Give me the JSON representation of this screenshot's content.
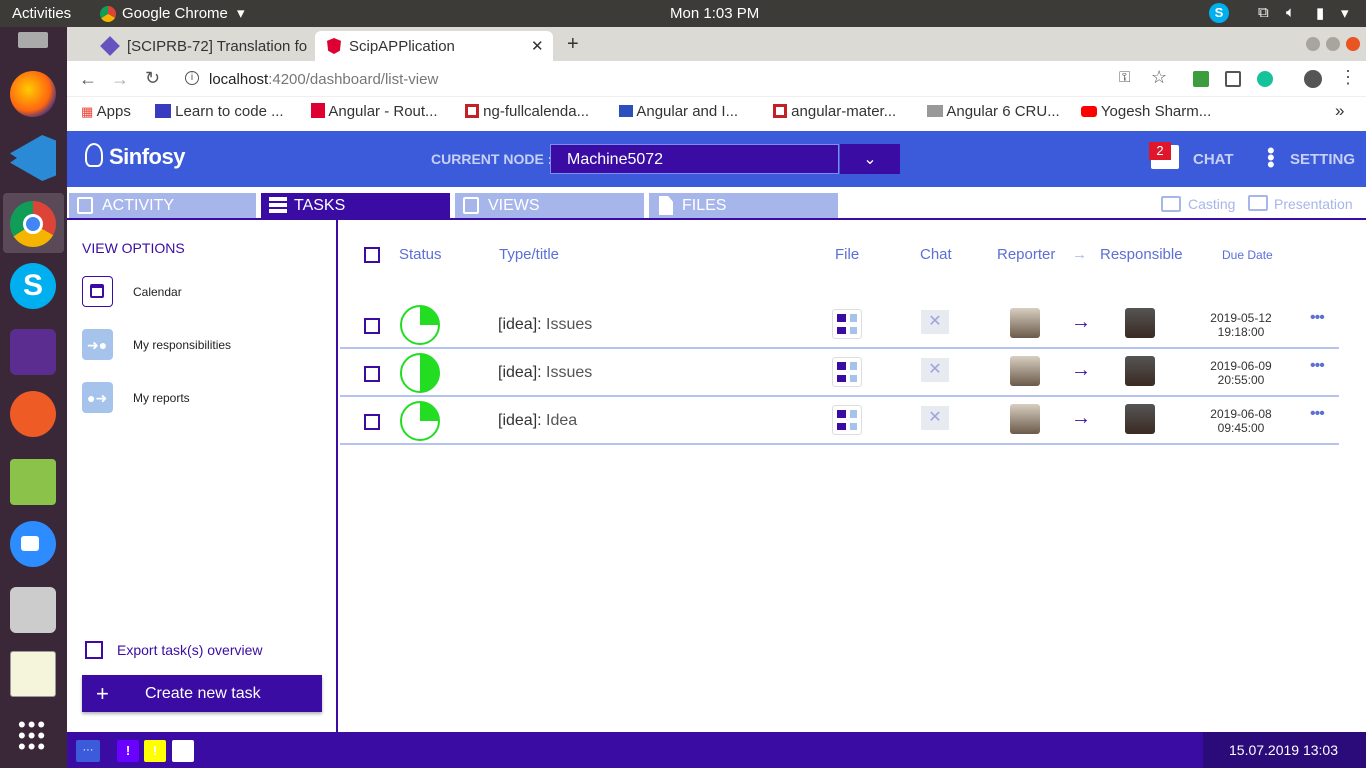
{
  "os": {
    "activities": "Activities",
    "app_menu": "Google Chrome",
    "clock": "Mon  1:03 PM"
  },
  "browser": {
    "tabs": [
      {
        "label": "[SCIPRB-72] Translation fo"
      },
      {
        "label": "ScipAPPlication"
      }
    ],
    "url_host": "localhost",
    "url_path": ":4200/dashboard/list-view",
    "bookmarks": [
      {
        "label": "Apps"
      },
      {
        "label": "Learn to code ..."
      },
      {
        "label": "Angular - Rout..."
      },
      {
        "label": "ng-fullcalenda..."
      },
      {
        "label": "Angular and I..."
      },
      {
        "label": "angular-mater..."
      },
      {
        "label": "Angular 6 CRU..."
      },
      {
        "label": "Yogesh Sharm..."
      }
    ],
    "bookmarks_overflow": "»"
  },
  "app": {
    "logo": "Sinfosy",
    "current_node_label": "CURRENT NODE :",
    "current_node_value": "Machine5072",
    "chat_label": "CHAT",
    "chat_badge": "2",
    "setting_label": "SETTING",
    "tabs": [
      {
        "label": "ACTIVITY"
      },
      {
        "label": "TASKS"
      },
      {
        "label": "VIEWS"
      },
      {
        "label": "FILES"
      }
    ],
    "casting": "Casting",
    "presentation": "Presentation"
  },
  "sidebar": {
    "title": "VIEW OPTIONS",
    "items": [
      {
        "label": "Calendar"
      },
      {
        "label": "My responsibilities"
      },
      {
        "label": "My reports"
      }
    ],
    "export_label": "Export task(s) overview",
    "create_label": "Create new task"
  },
  "table": {
    "headers": {
      "status": "Status",
      "type_title": "Type/title",
      "file": "File",
      "chat": "Chat",
      "reporter": "Reporter",
      "responsible": "Responsible",
      "due_date": "Due Date"
    },
    "rows": [
      {
        "type": "[idea]:",
        "title": "Issues",
        "due_date": "2019-05-12",
        "due_time": "19:18:00",
        "progress": 0.25
      },
      {
        "type": "[idea]:",
        "title": "Issues",
        "due_date": "2019-06-09",
        "due_time": "20:55:00",
        "progress": 0.5
      },
      {
        "type": "[idea]:",
        "title": "Idea",
        "due_date": "2019-06-08",
        "due_time": "09:45:00",
        "progress": 0.25
      }
    ]
  },
  "footer": {
    "datetime": "15.07.2019 13:03",
    "more": "···",
    "badge_icon": "!"
  },
  "colors": {
    "primary": "#3a0ca3",
    "header_blue": "#3b5bdb",
    "status_green": "#22dd22",
    "tab_inactive": "#a7b6ea",
    "link": "#5b6fd6"
  }
}
